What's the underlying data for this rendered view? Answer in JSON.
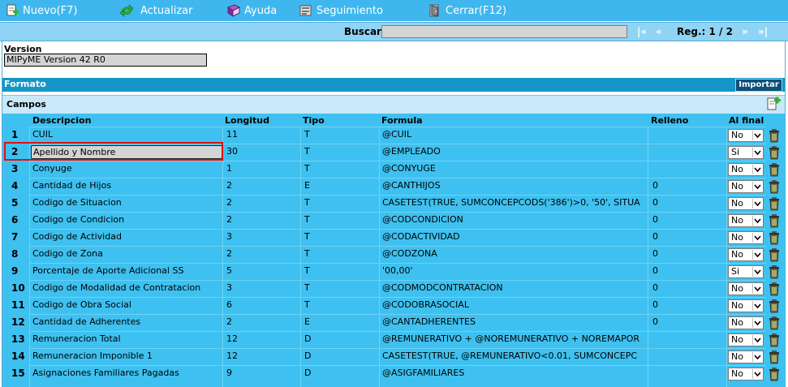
{
  "toolbar": {
    "nuevo": "Nuevo(F7)",
    "actualizar": "Actualizar",
    "ayuda": "Ayuda",
    "seguimiento": "Seguimiento",
    "cerrar": "Cerrar(F12)"
  },
  "search": {
    "label": "Buscar",
    "value": "",
    "nav_first": "|«",
    "nav_prev": "«",
    "nav_next": "»",
    "nav_last": "»|",
    "reg": "Reg.: 1 / 2"
  },
  "version": {
    "label": "Version",
    "value": "MIPyME Version 42 R0"
  },
  "formato": {
    "label": "Formato",
    "importar": "Importar"
  },
  "campos": {
    "label": "Campos",
    "headers": {
      "descripcion": "Descripcion",
      "longitud": "Longitud",
      "tipo": "Tipo",
      "formula": "Formula",
      "relleno": "Relleno",
      "al_final": "Al final"
    },
    "rows": [
      {
        "n": "1",
        "desc": "CUIL",
        "len": "11",
        "tipo": "T",
        "formula": "@CUIL",
        "relleno": "",
        "final": "No"
      },
      {
        "n": "2",
        "desc": "Apellido y Nombre",
        "len": "30",
        "tipo": "T",
        "formula": "@EMPLEADO",
        "relleno": "",
        "final": "Si"
      },
      {
        "n": "3",
        "desc": "Conyuge",
        "len": "1",
        "tipo": "T",
        "formula": "@CONYUGE",
        "relleno": "",
        "final": "No"
      },
      {
        "n": "4",
        "desc": "Cantidad de Hijos",
        "len": "2",
        "tipo": "E",
        "formula": "@CANTHIJOS",
        "relleno": "0",
        "final": "No"
      },
      {
        "n": "5",
        "desc": "Codigo de Situacion",
        "len": "2",
        "tipo": "T",
        "formula": "CASETEST(TRUE,  SUMCONCEPCODS('386')>0, '50', SITUA",
        "relleno": "0",
        "final": "No"
      },
      {
        "n": "6",
        "desc": "Codigo de Condicion",
        "len": "2",
        "tipo": "T",
        "formula": "@CODCONDICION",
        "relleno": "0",
        "final": "No"
      },
      {
        "n": "7",
        "desc": "Codigo de Actividad",
        "len": "3",
        "tipo": "T",
        "formula": "@CODACTIVIDAD",
        "relleno": "0",
        "final": "No"
      },
      {
        "n": "8",
        "desc": "Codigo de Zona",
        "len": "2",
        "tipo": "T",
        "formula": "@CODZONA",
        "relleno": "0",
        "final": "No"
      },
      {
        "n": "9",
        "desc": "Porcentaje de Aporte Adicional SS",
        "len": "5",
        "tipo": "T",
        "formula": "'00,00'",
        "relleno": "0",
        "final": "Si"
      },
      {
        "n": "10",
        "desc": "Codigo de Modalidad de Contratacion",
        "len": "3",
        "tipo": "T",
        "formula": "@CODMODCONTRATACION",
        "relleno": "0",
        "final": "No"
      },
      {
        "n": "11",
        "desc": "Codigo de Obra Social",
        "len": "6",
        "tipo": "T",
        "formula": "@CODOBRASOCIAL",
        "relleno": "0",
        "final": "No"
      },
      {
        "n": "12",
        "desc": "Cantidad de Adherentes",
        "len": "2",
        "tipo": "E",
        "formula": "@CANTADHERENTES",
        "relleno": "0",
        "final": "No"
      },
      {
        "n": "13",
        "desc": "Remuneracion Total",
        "len": "12",
        "tipo": "D",
        "formula": "@REMUNERATIVO + @NOREMUNERATIVO + NOREMAPOR",
        "relleno": "",
        "final": "No"
      },
      {
        "n": "14",
        "desc": "Remuneracion Imponible 1",
        "len": "12",
        "tipo": "D",
        "formula": "CASETEST(TRUE, @REMUNERATIVO<0.01, SUMCONCEPC",
        "relleno": "",
        "final": "No"
      },
      {
        "n": "15",
        "desc": "Asignaciones Familiares Pagadas",
        "len": "9",
        "tipo": "D",
        "formula": "@ASIGFAMILIARES",
        "relleno": "",
        "final": "No"
      }
    ]
  }
}
